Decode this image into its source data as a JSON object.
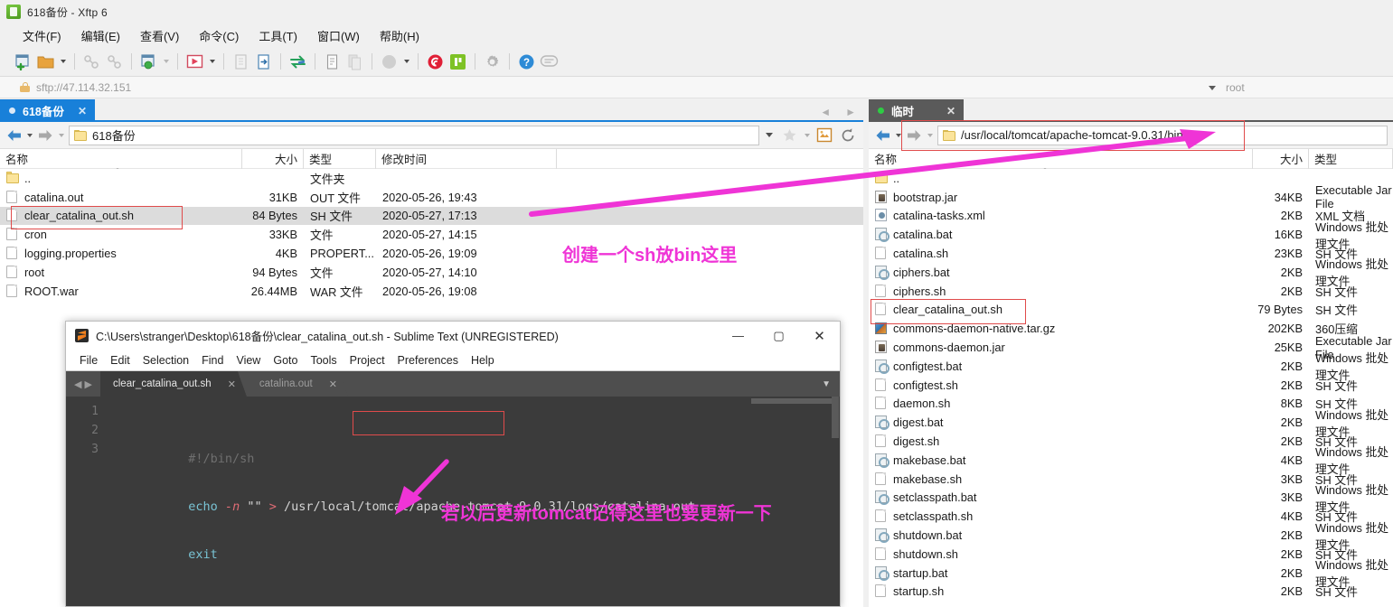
{
  "window": {
    "title": "618备份 - Xftp 6",
    "app_icon": "xftp-logo-icon"
  },
  "menubar": {
    "items": [
      "文件(F)",
      "编辑(E)",
      "查看(V)",
      "命令(C)",
      "工具(T)",
      "窗口(W)",
      "帮助(H)"
    ]
  },
  "toolbar": {
    "icons": [
      "new-session-icon",
      "open-folder-icon",
      "connect-icon",
      "disconnect-icon",
      "new-folder-icon",
      "transfer-run-icon",
      "copy-file-icon",
      "paste-file-icon",
      "sync-browse-icon",
      "edit-file-icon",
      "duplicate-icon",
      "view-mode-icon",
      "xshell-icon",
      "xftp-icon",
      "settings-gear-icon",
      "help-icon",
      "feedback-icon"
    ]
  },
  "connection": {
    "url": "sftp://47.114.32.151",
    "user": "root",
    "lock_icon": "lock-icon",
    "dropdown_icon": "chevron-down-icon"
  },
  "local_pane": {
    "tab": {
      "label": "618备份",
      "close": "✕",
      "status_dot": "connected-dot"
    },
    "path": "618备份",
    "nav": {
      "back_icon": "arrow-left-icon",
      "forward_icon": "arrow-right-icon",
      "folder_icon": "folder-icon"
    },
    "path_tools": [
      "bookmark-star-icon",
      "home-icon",
      "refresh-icon"
    ],
    "columns": [
      {
        "key": "name",
        "label": "名称"
      },
      {
        "key": "size",
        "label": "大小"
      },
      {
        "key": "type",
        "label": "类型"
      },
      {
        "key": "time",
        "label": "修改时间"
      }
    ],
    "rows": [
      {
        "icon": "folder-icon",
        "name": "..",
        "size": "",
        "type": "文件夹",
        "time": "",
        "selected": false
      },
      {
        "icon": "document-icon",
        "name": "catalina.out",
        "size": "31KB",
        "type": "OUT 文件",
        "time": "2020-05-26, 19:43",
        "selected": false
      },
      {
        "icon": "document-icon",
        "name": "clear_catalina_out.sh",
        "size": "84 Bytes",
        "type": "SH 文件",
        "time": "2020-05-27, 17:13",
        "selected": true
      },
      {
        "icon": "document-icon",
        "name": "cron",
        "size": "33KB",
        "type": "文件",
        "time": "2020-05-27, 14:15",
        "selected": false
      },
      {
        "icon": "document-icon",
        "name": "logging.properties",
        "size": "4KB",
        "type": "PROPERT...",
        "time": "2020-05-26, 19:09",
        "selected": false
      },
      {
        "icon": "document-icon",
        "name": "root",
        "size": "94 Bytes",
        "type": "文件",
        "time": "2020-05-27, 14:10",
        "selected": false
      },
      {
        "icon": "document-icon",
        "name": "ROOT.war",
        "size": "26.44MB",
        "type": "WAR 文件",
        "time": "2020-05-26, 19:08",
        "selected": false
      }
    ]
  },
  "remote_pane": {
    "tab": {
      "label": "临时",
      "close": "✕",
      "status_dot": "connected-dot-green"
    },
    "path": "/usr/local/tomcat/apache-tomcat-9.0.31/bin",
    "columns": [
      {
        "key": "name",
        "label": "名称"
      },
      {
        "key": "size",
        "label": "大小"
      },
      {
        "key": "type",
        "label": "类型"
      }
    ],
    "rows": [
      {
        "icon": "folder-icon",
        "name": "..",
        "size": "",
        "type": ""
      },
      {
        "icon": "jar-icon",
        "name": "bootstrap.jar",
        "size": "34KB",
        "type": "Executable Jar File"
      },
      {
        "icon": "xml-icon",
        "name": "catalina-tasks.xml",
        "size": "2KB",
        "type": "XML 文档"
      },
      {
        "icon": "bat-icon",
        "name": "catalina.bat",
        "size": "16KB",
        "type": "Windows 批处理文件"
      },
      {
        "icon": "document-icon",
        "name": "catalina.sh",
        "size": "23KB",
        "type": "SH 文件"
      },
      {
        "icon": "bat-icon",
        "name": "ciphers.bat",
        "size": "2KB",
        "type": "Windows 批处理文件"
      },
      {
        "icon": "document-icon",
        "name": "ciphers.sh",
        "size": "2KB",
        "type": "SH 文件"
      },
      {
        "icon": "document-icon",
        "name": "clear_catalina_out.sh",
        "size": "79 Bytes",
        "type": "SH 文件"
      },
      {
        "icon": "archive-icon",
        "name": "commons-daemon-native.tar.gz",
        "size": "202KB",
        "type": "360压缩"
      },
      {
        "icon": "jar-icon",
        "name": "commons-daemon.jar",
        "size": "25KB",
        "type": "Executable Jar File"
      },
      {
        "icon": "bat-icon",
        "name": "configtest.bat",
        "size": "2KB",
        "type": "Windows 批处理文件"
      },
      {
        "icon": "document-icon",
        "name": "configtest.sh",
        "size": "2KB",
        "type": "SH 文件"
      },
      {
        "icon": "document-icon",
        "name": "daemon.sh",
        "size": "8KB",
        "type": "SH 文件"
      },
      {
        "icon": "bat-icon",
        "name": "digest.bat",
        "size": "2KB",
        "type": "Windows 批处理文件"
      },
      {
        "icon": "document-icon",
        "name": "digest.sh",
        "size": "2KB",
        "type": "SH 文件"
      },
      {
        "icon": "bat-icon",
        "name": "makebase.bat",
        "size": "4KB",
        "type": "Windows 批处理文件"
      },
      {
        "icon": "document-icon",
        "name": "makebase.sh",
        "size": "3KB",
        "type": "SH 文件"
      },
      {
        "icon": "bat-icon",
        "name": "setclasspath.bat",
        "size": "3KB",
        "type": "Windows 批处理文件"
      },
      {
        "icon": "document-icon",
        "name": "setclasspath.sh",
        "size": "4KB",
        "type": "SH 文件"
      },
      {
        "icon": "bat-icon",
        "name": "shutdown.bat",
        "size": "2KB",
        "type": "Windows 批处理文件"
      },
      {
        "icon": "document-icon",
        "name": "shutdown.sh",
        "size": "2KB",
        "type": "SH 文件"
      },
      {
        "icon": "bat-icon",
        "name": "startup.bat",
        "size": "2KB",
        "type": "Windows 批处理文件"
      },
      {
        "icon": "document-icon",
        "name": "startup.sh",
        "size": "2KB",
        "type": "SH 文件"
      }
    ]
  },
  "sublime": {
    "title": "C:\\Users\\stranger\\Desktop\\618备份\\clear_catalina_out.sh - Sublime Text (UNREGISTERED)",
    "menu": [
      "File",
      "Edit",
      "Selection",
      "Find",
      "View",
      "Goto",
      "Tools",
      "Project",
      "Preferences",
      "Help"
    ],
    "window_buttons": {
      "minimize": "—",
      "maximize": "▢",
      "close": "✕"
    },
    "tabs": [
      {
        "label": "clear_catalina_out.sh",
        "active": true,
        "close": "✕"
      },
      {
        "label": "catalina.out",
        "active": false,
        "close": "✕"
      }
    ],
    "line_numbers": [
      "1",
      "2",
      "3"
    ],
    "code": {
      "line1": "#!/bin/sh",
      "line2_cmd": "echo",
      "line2_flag": "-n",
      "line2_str": "\"\"",
      "line2_op": ">",
      "line2_path_a": " /usr/local/tomcat/",
      "line2_path_b": "apache-tomcat-9.0.31",
      "line2_path_c": "/logs/catalina.out",
      "line3": "exit"
    }
  },
  "annotations": {
    "note_top": "创建一个sh放bin这里",
    "note_bottom": "若以后更新tomcat记得这里也要更新一下",
    "arrow_color": "#ef34d6",
    "highlight_box_color": "#e04b4b"
  }
}
